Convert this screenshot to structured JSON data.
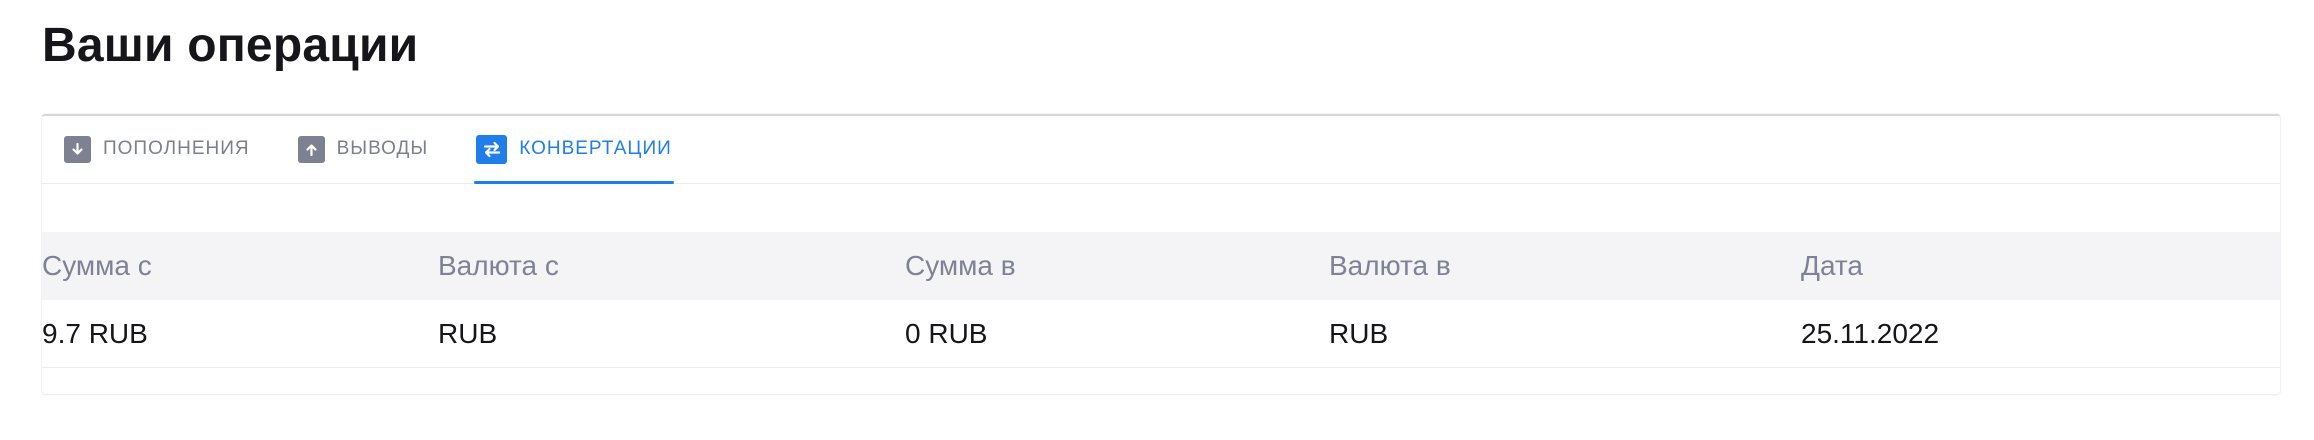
{
  "page": {
    "title": "Ваши операции"
  },
  "tabs": [
    {
      "label": "ПОПОЛНЕНИЯ",
      "icon": "arrow-down-icon",
      "active": false
    },
    {
      "label": "ВЫВОДЫ",
      "icon": "arrow-up-icon",
      "active": false
    },
    {
      "label": "КОНВЕРТАЦИИ",
      "icon": "swap-arrows-icon",
      "active": true
    }
  ],
  "colors": {
    "accent": "#1f7ee8",
    "tab_inactive": "#7b7f8e",
    "header_bg": "#f4f4f6",
    "header_text": "#7f8294"
  },
  "table": {
    "columns": [
      "Сумма с",
      "Валюта с",
      "Сумма в",
      "Валюта в",
      "Дата"
    ],
    "rows": [
      [
        "9.7 RUB",
        "RUB",
        "0 RUB",
        "RUB",
        "25.11.2022"
      ]
    ]
  }
}
